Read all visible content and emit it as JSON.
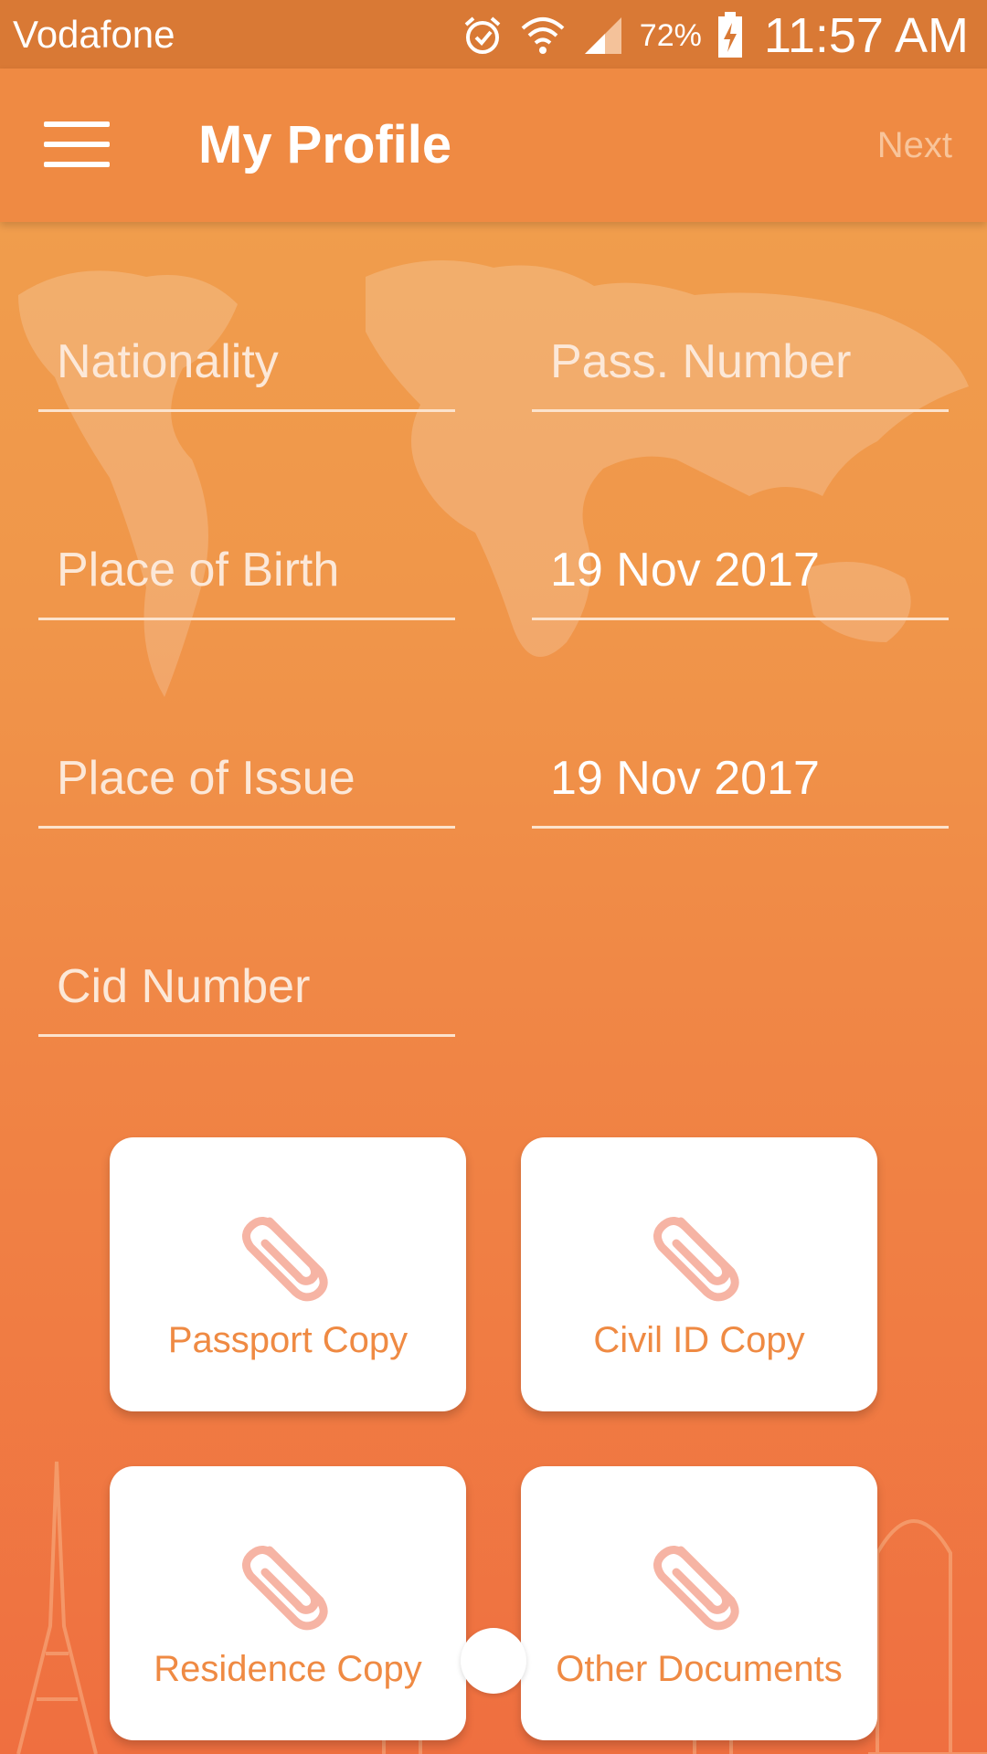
{
  "status_bar": {
    "carrier": "Vodafone",
    "battery": "72%",
    "time": "11:57 AM"
  },
  "app_bar": {
    "title": "My Profile",
    "next_label": "Next"
  },
  "form": {
    "nationality": "Nationality",
    "passport_number": "Pass. Number",
    "place_of_birth": "Place of Birth",
    "date_of_birth": "19 Nov 2017",
    "place_of_issue": "Place of Issue",
    "date_of_issue": "19 Nov 2017",
    "cid_number": "Cid Number"
  },
  "documents": {
    "passport": "Passport Copy",
    "civil_id": "Civil ID Copy",
    "residence": "Residence Copy",
    "other": "Other Documents"
  },
  "colors": {
    "accent": "#ef8a43",
    "status_bar": "#d97935",
    "icon_tint": "#f6b4a4"
  },
  "icons": [
    "menu-icon",
    "alarm-icon",
    "wifi-icon",
    "signal-icon",
    "battery-charging-icon",
    "paperclip-icon"
  ]
}
